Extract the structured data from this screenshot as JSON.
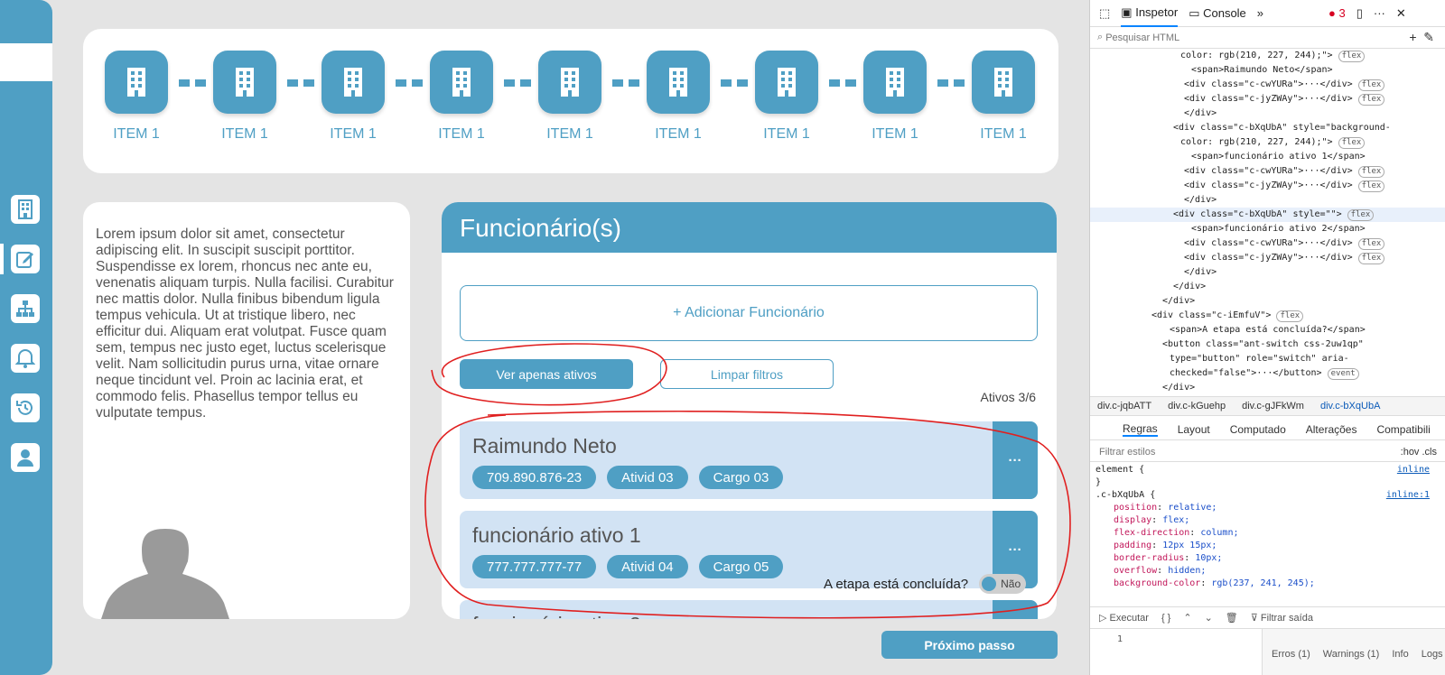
{
  "colors": {
    "accent": "#4f9fc4",
    "card_bg": "#d2e3f4",
    "annotation": "#e02020"
  },
  "stepper": {
    "items": [
      {
        "label": "ITEM 1"
      },
      {
        "label": "ITEM 1"
      },
      {
        "label": "ITEM 1"
      },
      {
        "label": "ITEM 1"
      },
      {
        "label": "ITEM 1"
      },
      {
        "label": "ITEM 1"
      },
      {
        "label": "ITEM 1"
      },
      {
        "label": "ITEM 1"
      },
      {
        "label": "ITEM 1"
      }
    ]
  },
  "sidebar": {
    "icons": [
      "building-icon",
      "edit-icon",
      "org-chart-icon",
      "notification-icon",
      "history-icon",
      "user-icon"
    ],
    "active": "edit-icon"
  },
  "info": {
    "text": "Lorem ipsum dolor sit amet, consectetur adipiscing elit. In suscipit suscipit porttitor. Suspendisse ex lorem, rhoncus nec ante eu, venenatis aliquam turpis. Nulla facilisi. Curabitur nec mattis dolor. Nulla finibus bibendum ligula tempus vehicula. Ut at tristique libero, nec efficitur dui. Aliquam erat volutpat. Fusce quam sem, tempus nec justo eget, luctus scelerisque velit. Nam sollicitudin purus urna, vitae ornare neque tincidunt vel. Proin ac lacinia erat, et commodo felis. Phasellus tempor tellus eu vulputate tempus."
  },
  "employees": {
    "title": "Funcionário(s)",
    "add_label": "+ Adicionar Funcionário",
    "filter_active_label": "Ver apenas ativos",
    "clear_filters_label": "Limpar filtros",
    "active_count": "Ativos 3/6",
    "menu_label": "···",
    "list": [
      {
        "name": "Raimundo Neto",
        "tags": [
          "709.890.876-23",
          "Ativid 03",
          "Cargo 03"
        ]
      },
      {
        "name": "funcionário ativo 1",
        "tags": [
          "777.777.777-77",
          "Ativid 04",
          "Cargo 05"
        ]
      },
      {
        "name": "funcionário ativo 2",
        "tags": []
      }
    ]
  },
  "stage": {
    "question": "A etapa está concluída?",
    "switch_label": "Não",
    "checked": false
  },
  "next_label": "Próximo passo",
  "devtools": {
    "tabs": {
      "inspector": "Inspetor",
      "console": "Console"
    },
    "error_count": "3",
    "search_placeholder": "Pesquisar HTML",
    "tree": [
      {
        "indent": 100,
        "t": "color: rgb(210, 227, 244);\">",
        "badge": "flex"
      },
      {
        "indent": 112,
        "t": "<span>Raimundo Neto</span>"
      },
      {
        "indent": 104,
        "t": "<div class=\"c-cwYURa\">···</div>",
        "badge": "flex"
      },
      {
        "indent": 104,
        "t": "<div class=\"c-jyZWAy\">···</div>",
        "badge": "flex"
      },
      {
        "indent": 104,
        "t": "</div>"
      },
      {
        "indent": 92,
        "t": "<div class=\"c-bXqUbA\" style=\"background-"
      },
      {
        "indent": 100,
        "t": "color: rgb(210, 227, 244);\">",
        "badge": "flex"
      },
      {
        "indent": 112,
        "t": "<span>funcionário ativo 1</span>"
      },
      {
        "indent": 104,
        "t": "<div class=\"c-cwYURa\">···</div>",
        "badge": "flex"
      },
      {
        "indent": 104,
        "t": "<div class=\"c-jyZWAy\">···</div>",
        "badge": "flex"
      },
      {
        "indent": 104,
        "t": "</div>"
      },
      {
        "indent": 92,
        "t": "<div class=\"c-bXqUbA\" style=\"\">",
        "badge": "flex",
        "sel": true
      },
      {
        "indent": 112,
        "t": "<span>funcionário ativo 2</span>"
      },
      {
        "indent": 104,
        "t": "<div class=\"c-cwYURa\">···</div>",
        "badge": "flex"
      },
      {
        "indent": 104,
        "t": "<div class=\"c-jyZWAy\">···</div>",
        "badge": "flex"
      },
      {
        "indent": 104,
        "t": "</div>"
      },
      {
        "indent": 92,
        "t": "</div>"
      },
      {
        "indent": 80,
        "t": "</div>"
      },
      {
        "indent": 68,
        "t": "<div class=\"c-iEmfuV\">",
        "badge": "flex"
      },
      {
        "indent": 88,
        "t": "<span>A etapa está concluída?</span>"
      },
      {
        "indent": 80,
        "t": "<button class=\"ant-switch css-2uw1qp\""
      },
      {
        "indent": 88,
        "t": "type=\"button\" role=\"switch\" aria-"
      },
      {
        "indent": 88,
        "t": "checked=\"false\">···</button>",
        "badge": "event"
      },
      {
        "indent": 80,
        "t": "</div>"
      },
      {
        "indent": 68,
        "t": "</div>"
      }
    ],
    "breadcrumbs": [
      "div.c-jqbATT",
      "div.c-kGuehp",
      "div.c-gJFkWm",
      "div.c-bXqUbA"
    ],
    "panel_tabs": [
      "Regras",
      "Layout",
      "Computado",
      "Alterações",
      "Compatibili"
    ],
    "filter_placeholder": "Filtrar estilos",
    "filter_tools": ":hov .cls",
    "rules": [
      {
        "t": "element {",
        "r": "inline"
      },
      {
        "t": "}"
      },
      {
        "t": ".c-bXqUbA {",
        "r": "inline:1"
      },
      {
        "p": "position",
        "v": "relative;"
      },
      {
        "p": "display",
        "v": "flex;"
      },
      {
        "p": "flex-direction",
        "v": "column;"
      },
      {
        "p": "padding",
        "v": "12px 15px;"
      },
      {
        "p": "border-radius",
        "v": "10px;"
      },
      {
        "p": "overflow",
        "v": "hidden;"
      },
      {
        "p": "background-color",
        "v": "rgb(237, 241, 245);"
      }
    ],
    "console": {
      "run": "Executar",
      "filter": "Filtrar saída",
      "line": "1",
      "errors": "Erros (1)",
      "warnings": "Warnings (1)",
      "info": "Info",
      "logs": "Logs ("
    }
  }
}
